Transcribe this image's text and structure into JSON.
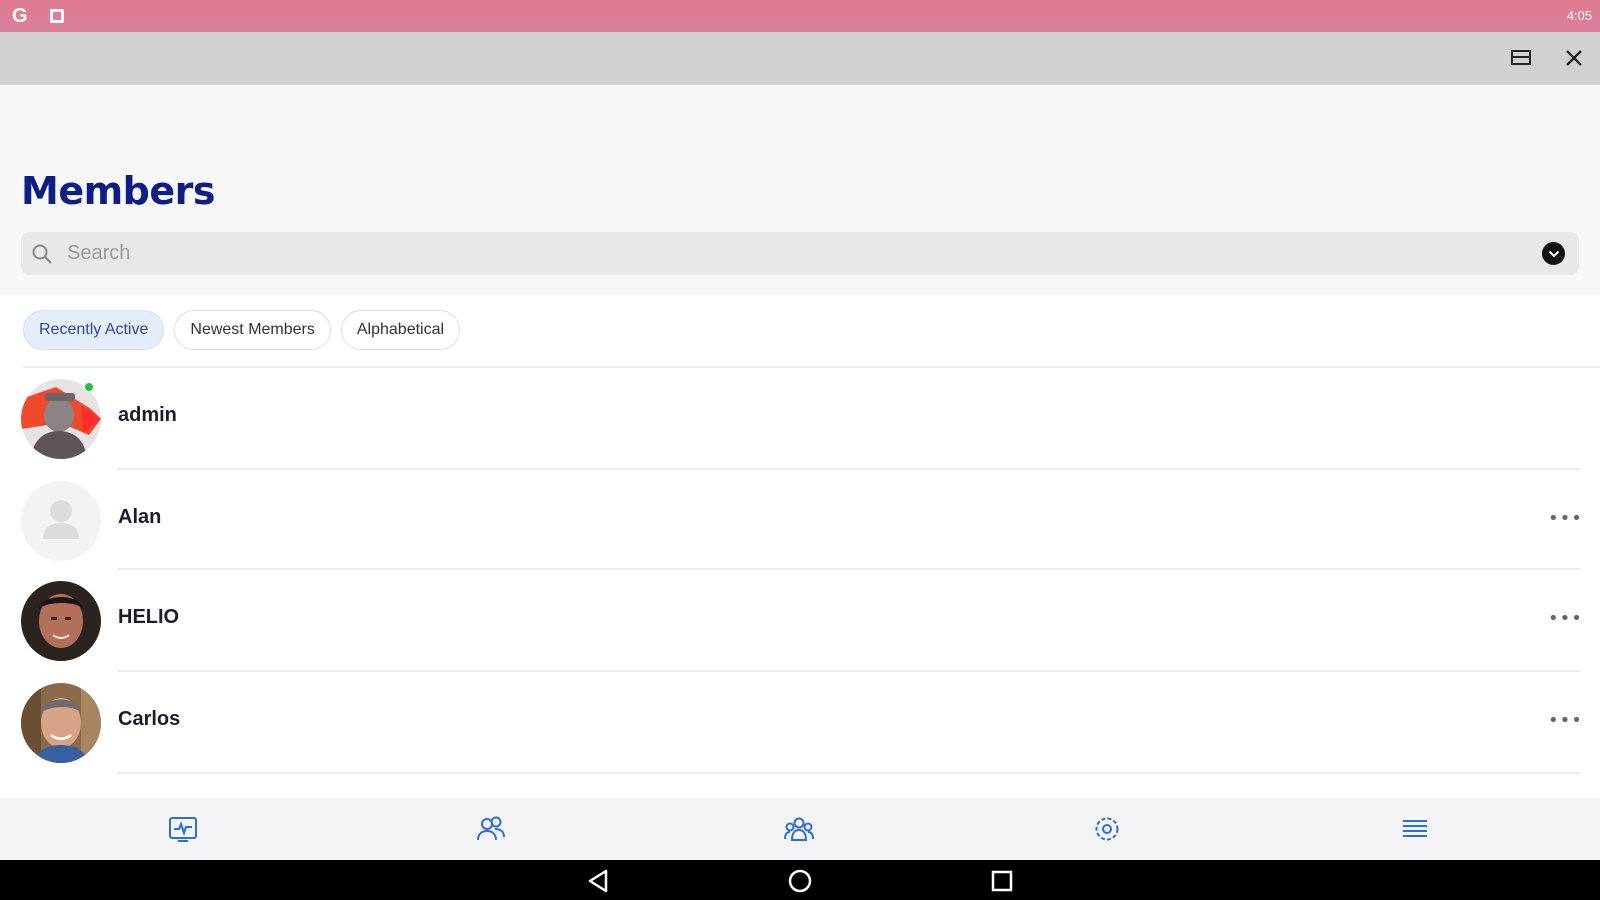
{
  "status_bar": {
    "time": "4:05",
    "google_icon": "google-icon",
    "notification_icon": "square-notification-icon"
  },
  "window": {
    "restore_icon": "window-restore-icon",
    "close_icon": "close-icon"
  },
  "page": {
    "title": "Members"
  },
  "search": {
    "placeholder": "Search",
    "value": "",
    "filter_icon": "chevron-down-icon"
  },
  "tabs": [
    {
      "label": "Recently Active",
      "active": true
    },
    {
      "label": "Newest Members",
      "active": false
    },
    {
      "label": "Alphabetical",
      "active": false
    }
  ],
  "members": [
    {
      "name": "admin",
      "online": true,
      "avatar": "photo",
      "has_menu": false
    },
    {
      "name": "Alan",
      "online": false,
      "avatar": "placeholder",
      "has_menu": true
    },
    {
      "name": "HELIO",
      "online": false,
      "avatar": "photo",
      "has_menu": true
    },
    {
      "name": "Carlos",
      "online": false,
      "avatar": "photo",
      "has_menu": true
    }
  ],
  "more_label": "•••",
  "bottom_nav": [
    {
      "icon": "activity-icon",
      "active": false
    },
    {
      "icon": "members-icon",
      "active": true
    },
    {
      "icon": "groups-icon",
      "active": false
    },
    {
      "icon": "settings-icon",
      "active": false
    },
    {
      "icon": "menu-list-icon",
      "active": false
    }
  ],
  "colors": {
    "title": "#0d1f86",
    "accent": "#2b6fd6",
    "online": "#21c13a",
    "status_bar": "#dd8099"
  }
}
